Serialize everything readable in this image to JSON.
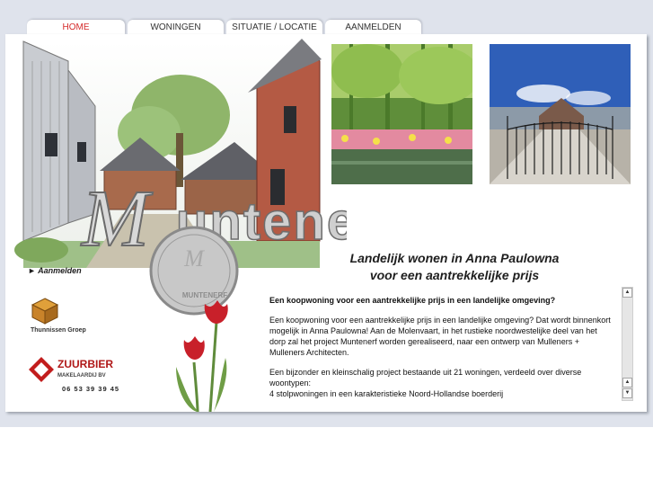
{
  "nav": {
    "tabs": [
      {
        "label": "HOME",
        "active": true
      },
      {
        "label": "WONINGEN",
        "active": false
      },
      {
        "label": "SITUATIE / LOCATIE",
        "active": false
      },
      {
        "label": "AANMELDEN",
        "active": false
      }
    ]
  },
  "branding": {
    "logo_word": "Muntenerf",
    "seal_text": "MUNTENERF"
  },
  "slogan": {
    "line1": "Landelijk wonen in Anna Paulowna",
    "line2": "voor een aantrekkelijke prijs"
  },
  "sidebar": {
    "link_label": "► Aanmelden",
    "partner1": "Thunnissen Groep",
    "partner2_name": "ZUURBIER",
    "partner2_sub": "MAKELAARDIJ BV",
    "phone": "06 53 39 39 45"
  },
  "content": {
    "heading": "Een koopwoning voor een aantrekkelijke prijs in een landelijke omgeving?",
    "para1": "Een koopwoning voor een aantrekkelijke prijs in een landelijke omgeving? Dat wordt binnenkort mogelijk in Anna Paulowna! Aan de Molenvaart, in het rustieke noordwestelijke deel van het dorp zal het project Muntenerf worden gerealiseerd, naar een ontwerp van Mulleners + Mulleners Architecten.",
    "para2": "Een bijzonder en kleinschalig project bestaande uit 21 woningen, verdeeld over diverse woontypen:",
    "para3": "4 stolpwoningen in een karakteristieke Noord-Hollandse boerderij"
  },
  "colors": {
    "accent": "#d42a2a",
    "background": "#dfe3ec"
  }
}
